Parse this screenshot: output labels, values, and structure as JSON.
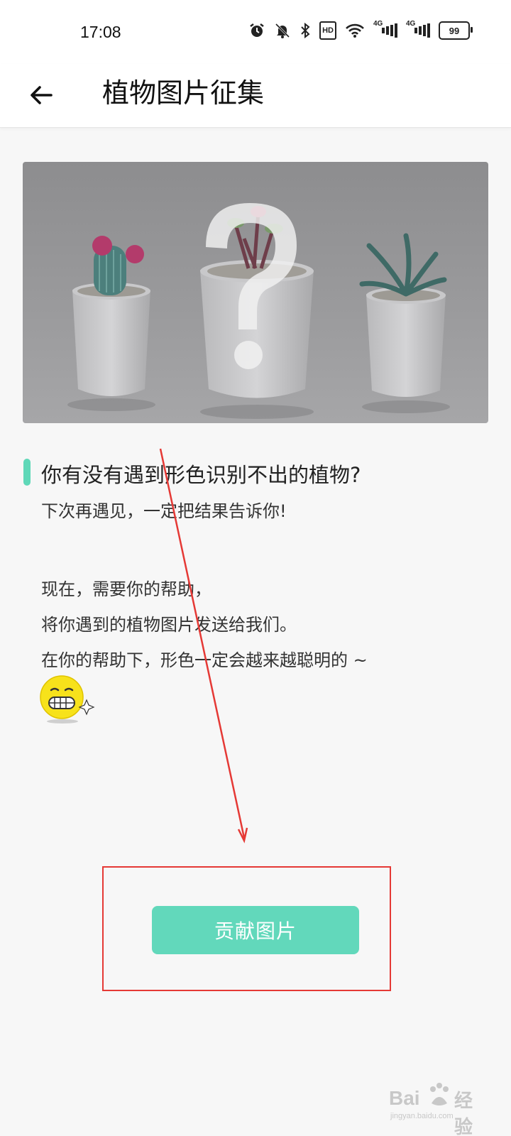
{
  "status_bar": {
    "time": "17:08",
    "hd_label": "HD",
    "signal_label_1": "4G",
    "signal_label_2": "4G",
    "battery": "99",
    "icons": [
      "alarm-icon",
      "mute-bell-icon",
      "bluetooth-icon",
      "hd-icon",
      "wifi-icon",
      "signal-4g-icon",
      "signal-4g-icon",
      "battery-icon"
    ]
  },
  "app_bar": {
    "back_icon": "arrow-left-icon",
    "title": "植物图片征集"
  },
  "hero": {
    "image": "three potted plants (cactus, succulent, aloe) in white pots with a large question mark overlay",
    "icon": "question-mark-icon"
  },
  "content": {
    "headline": "你有没有遇到形色识别不出的植物?",
    "line1": "下次再遇见，一定把结果告诉你!",
    "line2": "现在，需要你的帮助，",
    "line3": "将你遇到的植物图片发送给我们。",
    "line4": "在你的帮助下，形色一定会越来越聪明的 ~"
  },
  "button": {
    "label": "贡献图片"
  },
  "watermark": {
    "brand": "Bai",
    "brand2": "经验",
    "url": "jingyan.baidu.com"
  },
  "colors": {
    "accent": "#62d8bb",
    "annotation": "#e53935",
    "background": "#f7f7f7"
  }
}
